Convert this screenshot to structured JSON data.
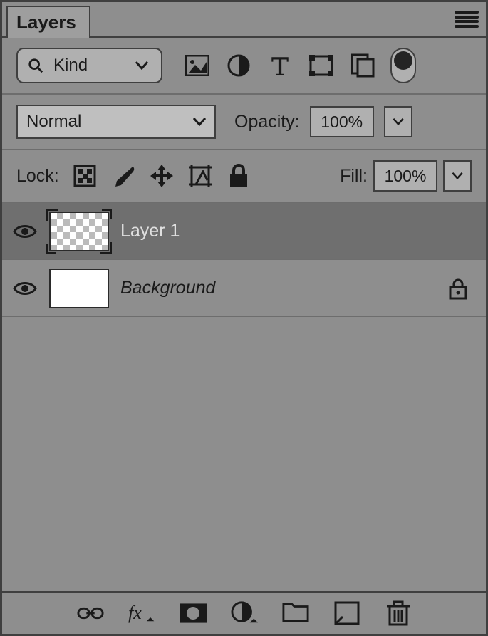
{
  "panel": {
    "title": "Layers"
  },
  "filter": {
    "kind_label": "Kind"
  },
  "blend": {
    "mode": "Normal"
  },
  "opacity": {
    "label": "Opacity:",
    "value": "100%"
  },
  "lock": {
    "label": "Lock:"
  },
  "fill": {
    "label": "Fill:",
    "value": "100%"
  },
  "layers": [
    {
      "name": "Layer 1",
      "visible": true,
      "selected": true,
      "locked": false,
      "thumb": "checker",
      "italic": false
    },
    {
      "name": "Background",
      "visible": true,
      "selected": false,
      "locked": true,
      "thumb": "white",
      "italic": true
    }
  ]
}
